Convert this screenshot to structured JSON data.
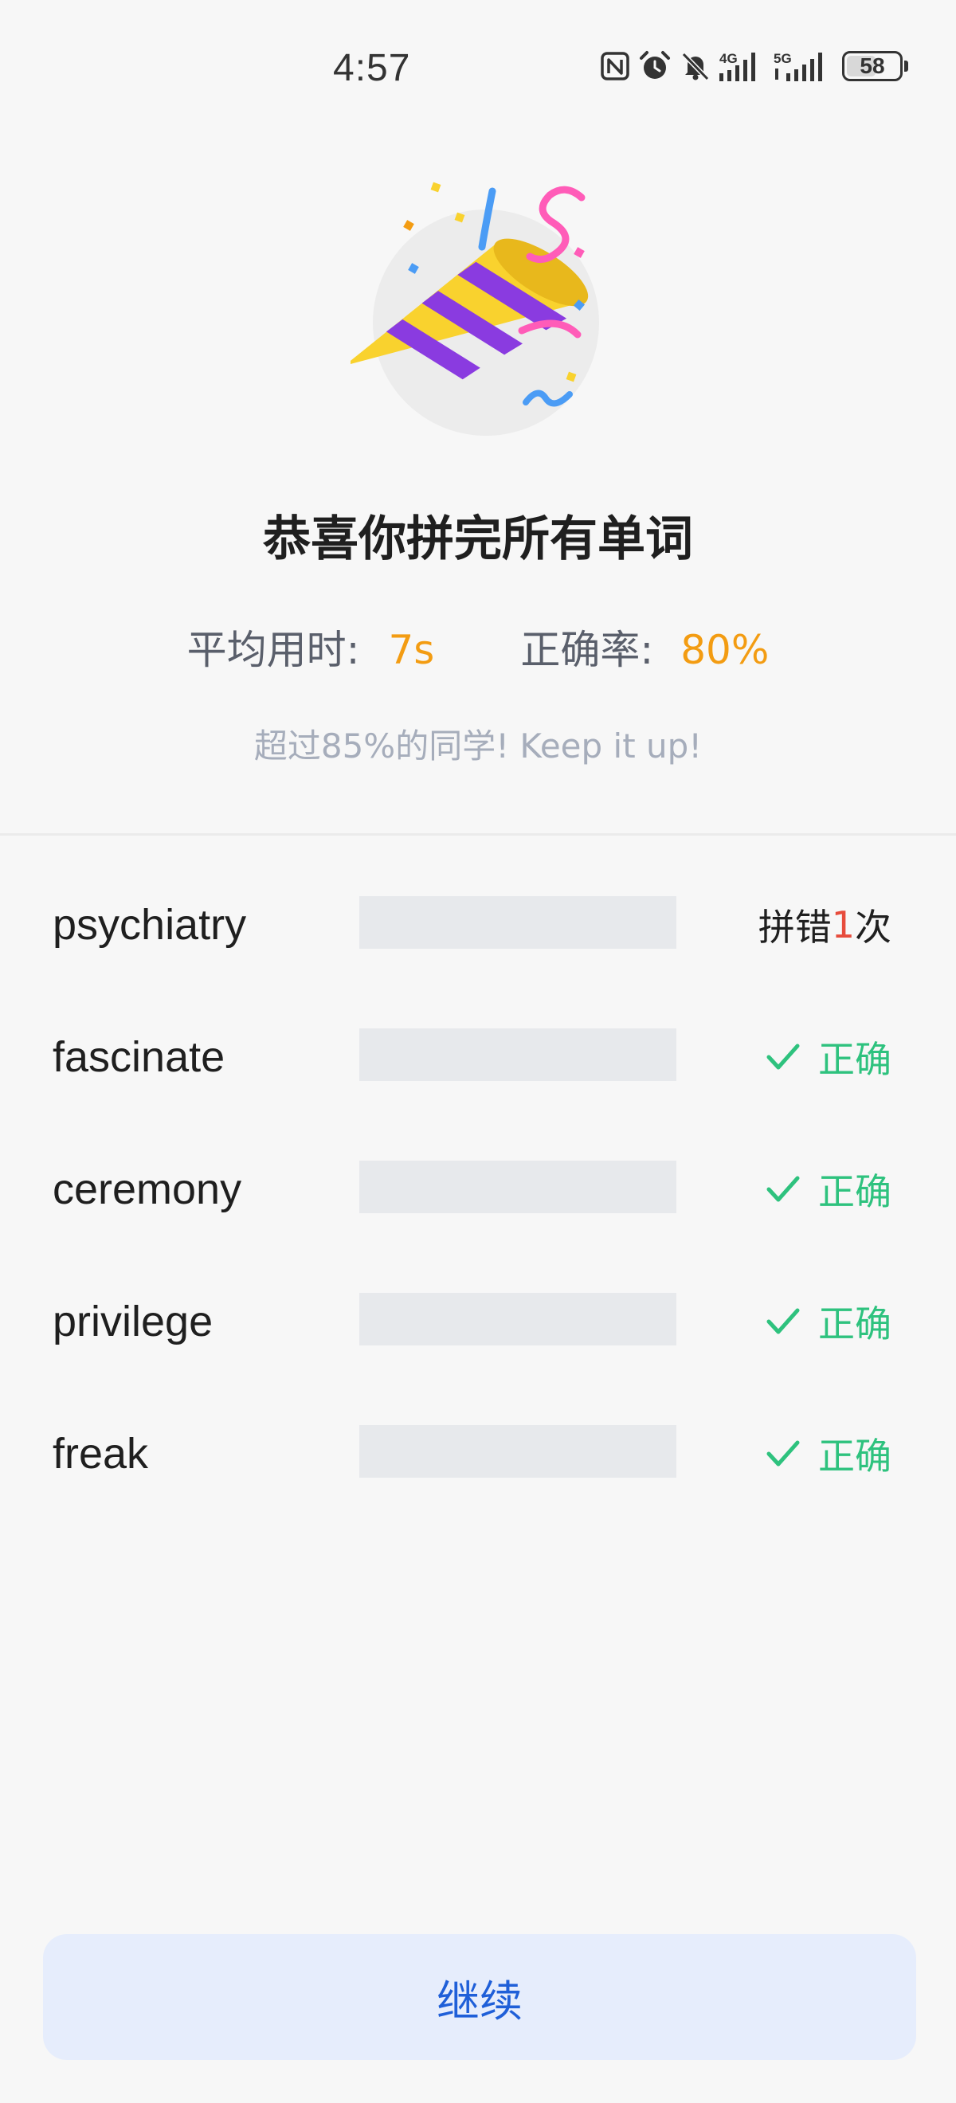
{
  "status_bar": {
    "time": "4:57",
    "battery": "58",
    "battery_level": 0.58,
    "icons": [
      "nfc-icon",
      "alarm-icon",
      "mute-icon",
      "signal-4g-icon",
      "signal-5g-icon",
      "battery-icon"
    ],
    "network_labels": [
      "4G",
      "5G"
    ]
  },
  "hero": {
    "icon": "party-popper-icon",
    "title": "恭喜你拼完所有单词"
  },
  "stats": {
    "avg_time_label": "平均用时:",
    "avg_time_value": "7s",
    "accuracy_label": "正确率:",
    "accuracy_value": "80%",
    "value_color": "#f39c12"
  },
  "encourage": "超过85%的同学!  Keep it up!",
  "words": [
    {
      "word": "psychiatry",
      "result": "wrong",
      "prefix": "拼错",
      "count": "1",
      "suffix": "次"
    },
    {
      "word": "fascinate",
      "result": "correct",
      "label": "正确"
    },
    {
      "word": "ceremony",
      "result": "correct",
      "label": "正确"
    },
    {
      "word": "privilege",
      "result": "correct",
      "label": "正确"
    },
    {
      "word": "freak",
      "result": "correct",
      "label": "正确"
    }
  ],
  "colors": {
    "correct": "#2ec27e",
    "wrong_count": "#e74c3c",
    "button_bg": "#e6edfc",
    "button_text": "#1f5fd8"
  },
  "continue_button": "继续"
}
